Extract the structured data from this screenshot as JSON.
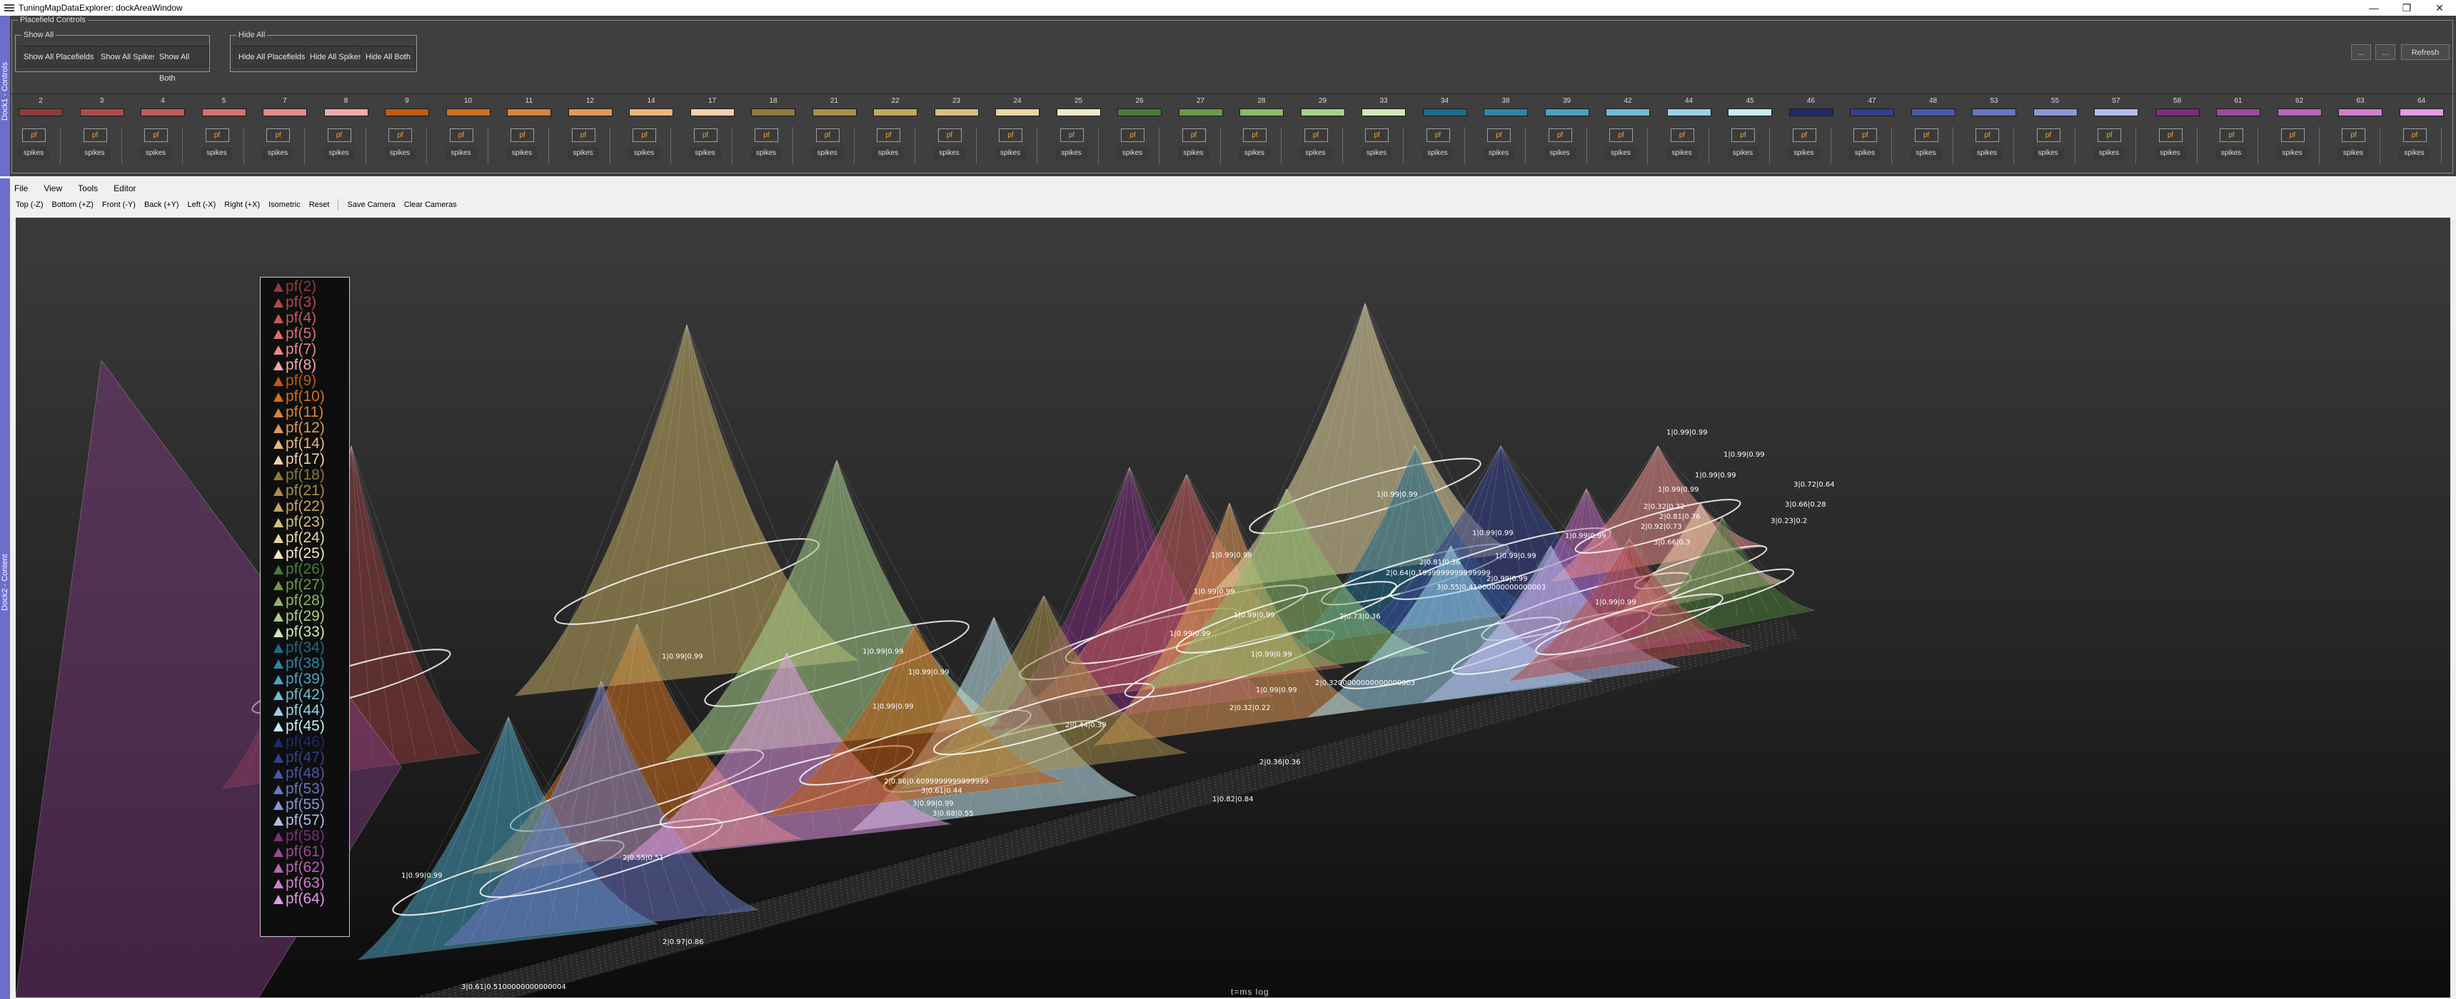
{
  "window": {
    "title": "TuningMapDataExplorer: dockAreaWindow",
    "controls": [
      "—",
      "❐",
      "✕"
    ]
  },
  "dock1": {
    "side_label": "Dock1 - Controls",
    "group_title": "Placefield Controls",
    "show_all": {
      "title": "Show All",
      "buttons": [
        "Show All Placefields",
        "Show All Spikes",
        "Show All Both"
      ]
    },
    "hide_all": {
      "title": "Hide All",
      "buttons": [
        "Hide All Placefields",
        "Hide All Spikes",
        "Hide All Both"
      ]
    },
    "right_buttons": [
      "...",
      "...",
      "Refresh"
    ],
    "cells": [
      {
        "id": "2",
        "color": "#8e3b3b"
      },
      {
        "id": "3",
        "color": "#b04a4a"
      },
      {
        "id": "4",
        "color": "#c25a5a"
      },
      {
        "id": "5",
        "color": "#d97070"
      },
      {
        "id": "7",
        "color": "#e88a8a"
      },
      {
        "id": "8",
        "color": "#f0aaaa"
      },
      {
        "id": "9",
        "color": "#c05a10"
      },
      {
        "id": "10",
        "color": "#d07020"
      },
      {
        "id": "11",
        "color": "#d8843a"
      },
      {
        "id": "12",
        "color": "#e09a56"
      },
      {
        "id": "14",
        "color": "#ecb57a"
      },
      {
        "id": "17",
        "color": "#f4d0a8"
      },
      {
        "id": "18",
        "color": "#8e7a3e"
      },
      {
        "id": "21",
        "color": "#a8904a"
      },
      {
        "id": "22",
        "color": "#c0a860"
      },
      {
        "id": "23",
        "color": "#d6c080"
      },
      {
        "id": "24",
        "color": "#e8d6a0"
      },
      {
        "id": "25",
        "color": "#f2e8c8"
      },
      {
        "id": "26",
        "color": "#4a7a3a"
      },
      {
        "id": "27",
        "color": "#6a9a4a"
      },
      {
        "id": "28",
        "color": "#8aba6a"
      },
      {
        "id": "29",
        "color": "#a8d08a"
      },
      {
        "id": "33",
        "color": "#cfe8b0"
      },
      {
        "id": "34",
        "color": "#1e6a8a"
      },
      {
        "id": "38",
        "color": "#2e86a6"
      },
      {
        "id": "39",
        "color": "#4aa2c0"
      },
      {
        "id": "42",
        "color": "#70bcd6"
      },
      {
        "id": "44",
        "color": "#9ad2e6"
      },
      {
        "id": "45",
        "color": "#c6ecf6"
      },
      {
        "id": "46",
        "color": "#202a6a"
      },
      {
        "id": "47",
        "color": "#34408a"
      },
      {
        "id": "48",
        "color": "#4a58a8"
      },
      {
        "id": "53",
        "color": "#6a76c0"
      },
      {
        "id": "55",
        "color": "#8c96d6"
      },
      {
        "id": "57",
        "color": "#b4bcec"
      },
      {
        "id": "58",
        "color": "#7a2e7a"
      },
      {
        "id": "61",
        "color": "#9a4a9a"
      },
      {
        "id": "62",
        "color": "#b866b8"
      },
      {
        "id": "63",
        "color": "#d07ed0"
      },
      {
        "id": "64",
        "color": "#e49ae4"
      }
    ],
    "pf_label": "pf",
    "spikes_label": "spikes"
  },
  "dock2": {
    "side_label": "Dock2 - Content",
    "menu": [
      "File",
      "View",
      "Tools",
      "Editor"
    ],
    "camera_views": [
      "Top (-Z)",
      "Bottom (+Z)",
      "Front (-Y)",
      "Back (+Y)",
      "Left (-X)",
      "Right (+X)",
      "Isometric",
      "Reset"
    ],
    "camera_actions": [
      "Save Camera",
      "Clear Cameras"
    ],
    "status_text": "t=ms log"
  },
  "legend": [
    {
      "label": "pf(2)",
      "color": "#8e3b3b"
    },
    {
      "label": "pf(3)",
      "color": "#b04a4a"
    },
    {
      "label": "pf(4)",
      "color": "#c25a5a"
    },
    {
      "label": "pf(5)",
      "color": "#d97070"
    },
    {
      "label": "pf(7)",
      "color": "#e88a8a"
    },
    {
      "label": "pf(8)",
      "color": "#f0aaaa"
    },
    {
      "label": "pf(9)",
      "color": "#c05a10"
    },
    {
      "label": "pf(10)",
      "color": "#d07020"
    },
    {
      "label": "pf(11)",
      "color": "#d8843a"
    },
    {
      "label": "pf(12)",
      "color": "#e09a56"
    },
    {
      "label": "pf(14)",
      "color": "#ecb57a"
    },
    {
      "label": "pf(17)",
      "color": "#f4d0a8"
    },
    {
      "label": "pf(18)",
      "color": "#8e7a3e"
    },
    {
      "label": "pf(21)",
      "color": "#a8904a"
    },
    {
      "label": "pf(22)",
      "color": "#c0a860"
    },
    {
      "label": "pf(23)",
      "color": "#d6c080"
    },
    {
      "label": "pf(24)",
      "color": "#e8d6a0"
    },
    {
      "label": "pf(25)",
      "color": "#f2e8c8"
    },
    {
      "label": "pf(26)",
      "color": "#4a7a3a"
    },
    {
      "label": "pf(27)",
      "color": "#6a9a4a"
    },
    {
      "label": "pf(28)",
      "color": "#8aba6a"
    },
    {
      "label": "pf(29)",
      "color": "#a8d08a"
    },
    {
      "label": "pf(33)",
      "color": "#cfe8b0"
    },
    {
      "label": "pf(34)",
      "color": "#1e6a8a"
    },
    {
      "label": "pf(38)",
      "color": "#2e86a6"
    },
    {
      "label": "pf(39)",
      "color": "#4aa2c0"
    },
    {
      "label": "pf(42)",
      "color": "#70bcd6"
    },
    {
      "label": "pf(44)",
      "color": "#9ad2e6"
    },
    {
      "label": "pf(45)",
      "color": "#c6ecf6"
    },
    {
      "label": "pf(46)",
      "color": "#202a6a"
    },
    {
      "label": "pf(47)",
      "color": "#34408a"
    },
    {
      "label": "pf(48)",
      "color": "#4a58a8"
    },
    {
      "label": "pf(53)",
      "color": "#6a76c0"
    },
    {
      "label": "pf(55)",
      "color": "#8c96d6"
    },
    {
      "label": "pf(57)",
      "color": "#b4bcec"
    },
    {
      "label": "pf(58)",
      "color": "#7a2e7a"
    },
    {
      "label": "pf(61)",
      "color": "#9a4a9a"
    },
    {
      "label": "pf(62)",
      "color": "#b866b8"
    },
    {
      "label": "pf(63)",
      "color": "#d07ed0"
    },
    {
      "label": "pf(64)",
      "color": "#e49ae4"
    }
  ],
  "peak_labels": [
    "1|0.99|0.99",
    "1|0.99|0.99",
    "1|0.99|0.99",
    "1|0.99|0.99",
    "1|0.99|0.99",
    "1|0.99|0.99",
    "1|0.99|0.99",
    "1|0.99|0.99",
    "1|0.99|0.99",
    "2|0.99|0.99",
    "1|0.99|0.99",
    "1|0.99|0.99",
    "1|0.99|0.99",
    "1|0.99|0.99",
    "1|0.99|0.99",
    "1|0.99|0.99",
    "1|0.99|0.99",
    "1|0.99|0.99",
    "1|0.99|0.99",
    "1|0.99|0.99",
    "1|0.99|0.99",
    "3|0.72|0.64",
    "3|0.66|0.28",
    "3|0.23|0.2",
    "2|0.81|0.76",
    "2|0.92|0.73",
    "3|0.66|0.3",
    "2|0.32|0.22",
    "2|0.64|0.1999999999999999",
    "3|0.55|0.41000000000000003",
    "2|0.81|0.36",
    "2|0.73|0.36",
    "2|0.44|0.39",
    "2|0.32|0.22",
    "2|0.3200000000000000003",
    "2|0.86|0.6099999999999999",
    "3|0.61|0.44",
    "3|0.99|0.99",
    "3|0.68|0.55",
    "2|0.97|0.86",
    "3|0.61|0.5100000000000004",
    "1|0.82|0.84",
    "2|0.36|0.36",
    "2|0.55|0.51"
  ]
}
